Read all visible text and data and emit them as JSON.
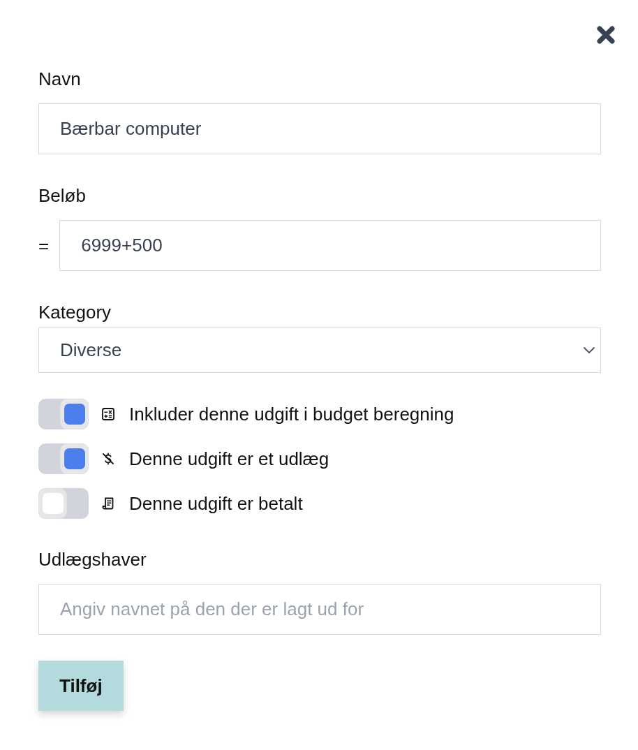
{
  "fields": [
    {
      "kind": "text",
      "label": "Navn",
      "value": "Bærbar computer"
    },
    {
      "kind": "formula",
      "label": "Beløb",
      "prefix": "=",
      "value": "6999+500"
    },
    {
      "kind": "select",
      "label": "Kategory",
      "value": "Diverse"
    }
  ],
  "toggles": [
    {
      "label": "Inkluder denne udgift i budget beregning",
      "on": true
    },
    {
      "label": "Denne udgift er et udlæg",
      "on": true
    },
    {
      "label": "Denne udgift er betalt",
      "on": false
    }
  ],
  "payee_field": {
    "label": "Udlægshaver",
    "placeholder": "Angiv navnet på den der er lagt ud for"
  },
  "submit_button": {
    "label": "Tilføj"
  }
}
